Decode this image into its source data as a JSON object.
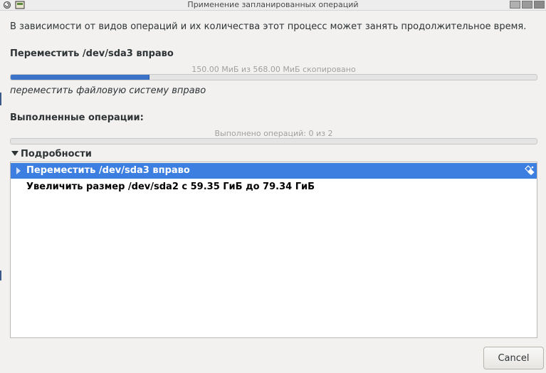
{
  "window": {
    "title": "Применение запланированных операций"
  },
  "intro_text": "В зависимости от видов операций и их количества этот процесс может занять продолжительное время.",
  "current_operation": {
    "title": "Переместить /dev/sda3 вправо",
    "progress_text": "150.00 МиБ из 568.00 МиБ скопировано",
    "progress_fraction": 0.264,
    "subtask": "переместить файловую систему вправо"
  },
  "completed": {
    "title": "Выполненные операции:",
    "progress_text": "Выполнено операций: 0 из 2",
    "progress_fraction": 0.0
  },
  "details": {
    "label": "Подробности",
    "expanded": true,
    "rows": [
      {
        "label": "Переместить /dev/sda3 вправо",
        "selected": true,
        "status_icon": "executing-icon"
      },
      {
        "label": "Увеличить размер /dev/sda2 с 59.35 ГиБ до 79.34 ГиБ",
        "selected": false
      }
    ]
  },
  "buttons": {
    "cancel_label": "Cancel"
  },
  "colors": {
    "accent": "#3d7fe0",
    "progress_fill": "#3a73c8"
  }
}
